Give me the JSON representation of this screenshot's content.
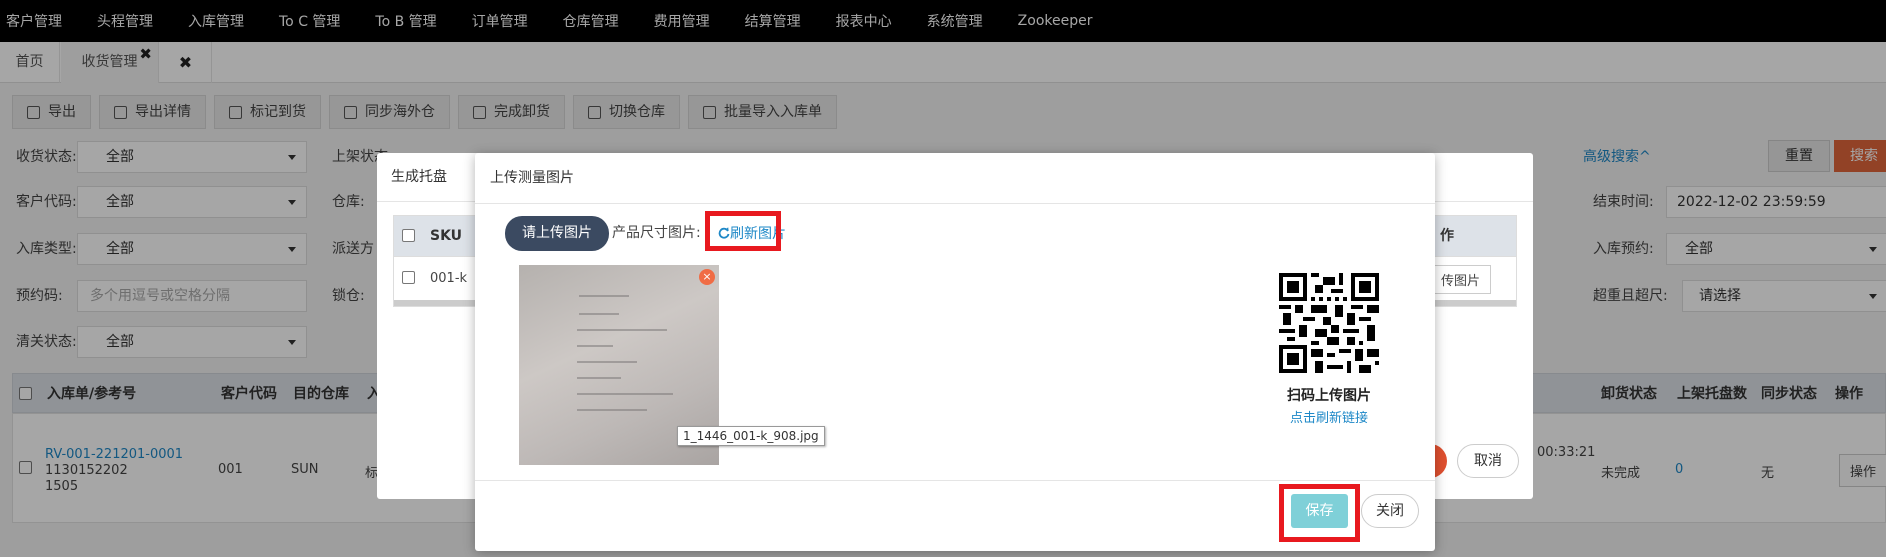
{
  "nav": {
    "items": [
      "客户管理",
      "头程管理",
      "入库管理",
      "To C 管理",
      "To B 管理",
      "订单管理",
      "仓库管理",
      "费用管理",
      "结算管理",
      "报表中心",
      "系统管理",
      "Zookeeper"
    ]
  },
  "tabs": {
    "home": "首页",
    "active": "收货管理",
    "active_close": "✖",
    "close_all": "✖"
  },
  "toolbar": {
    "buttons": [
      "导出",
      "导出详情",
      "标记到货",
      "同步海外仓",
      "完成卸货",
      "切换仓库",
      "批量导入入库单"
    ]
  },
  "filters": {
    "receive_status": {
      "label": "收货状态:",
      "value": "全部"
    },
    "shelf_status": {
      "label": "上架状态"
    },
    "customer_code": {
      "label": "客户代码:",
      "value": "全部"
    },
    "warehouse": {
      "label": "仓库:"
    },
    "inbound_type": {
      "label": "入库类型:",
      "value": "全部"
    },
    "delivery": {
      "label": "派送方"
    },
    "prebook_code": {
      "label": "预约码:",
      "placeholder": "多个用逗号或空格分隔"
    },
    "lock": {
      "label": "锁仓:"
    },
    "clearance": {
      "label": "清关状态:",
      "value": "全部"
    },
    "advanced": "高级搜索^",
    "reset": "重置",
    "search": "搜索",
    "end_time": {
      "label": "结束时间:",
      "value": "2022-12-02 23:59:59"
    },
    "inbound_prebook": {
      "label": "入库预约:",
      "value": "全部"
    },
    "overdue": {
      "label": "超重且超尺:",
      "value": "请选择"
    }
  },
  "table": {
    "headers": [
      "入库单/参考号",
      "客户代码",
      "目的仓库",
      "入",
      "卸货状态",
      "上架托盘数",
      "同步状态",
      "操作"
    ],
    "row": {
      "order": "RV-001-221201-0001",
      "ref1": "1130152202",
      "ref2": "1505",
      "customer": "001",
      "warehouse": "SUN",
      "type": "标",
      "time": "00:33:21",
      "unload": "未完成",
      "pallets": "0",
      "sync": "无",
      "action": "操作"
    }
  },
  "modal_pallet": {
    "title": "生成托盘",
    "sku_header": "SKU",
    "sku_value": "001-k",
    "right_header": "作",
    "right_btn": "传图片",
    "cancel": "取消"
  },
  "modal_upload": {
    "title": "上传测量图片",
    "upload_btn": "请上传图片",
    "dim_label": "产品尺寸图片:",
    "refresh": "刷新图片",
    "filename": "1_1446_001-k_908.jpg",
    "qr_text": "扫码上传图片",
    "qr_link": "点击刷新链接",
    "save": "保存",
    "close": "关闭",
    "photo_delete": "×"
  },
  "colors": {
    "nav_bg": "#000000",
    "primary_dark": "#3b4a61",
    "link": "#1e88c7",
    "highlight": "#e8191f",
    "save": "#7fd0d8",
    "search": "#e0663b"
  }
}
